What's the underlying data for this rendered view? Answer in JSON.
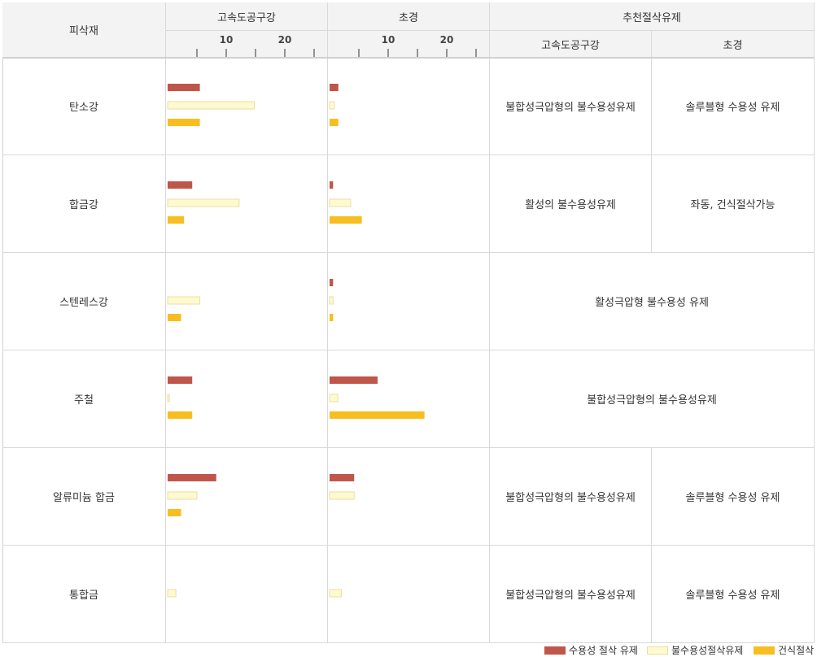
{
  "header": {
    "material": "피삭재",
    "group_a": "고속도공구강",
    "group_b": "초경",
    "recommend": "추천절삭유제",
    "rec_a": "고속도공구강",
    "rec_b": "초경"
  },
  "legend": {
    "water": "수용성 절삭 유제",
    "nonwater": "불수용성절삭유제",
    "dry": "건식절삭"
  },
  "colors": {
    "water": "#c0564a",
    "nonwater": "#fff9cf",
    "nonwater_border": "#e8dfa0",
    "dry": "#f8be1f"
  },
  "chart_data": {
    "type": "bar",
    "orientation": "horizontal",
    "xlim": [
      0,
      25
    ],
    "ticks": [
      10,
      20
    ],
    "series": [
      {
        "name": "수용성 절삭 유제"
      },
      {
        "name": "불수용성절삭유제"
      },
      {
        "name": "건식절삭"
      }
    ],
    "rows": [
      {
        "material": "탄소강",
        "hss": [
          5.5,
          14.8,
          5.5
        ],
        "carbide": [
          1.5,
          0.8,
          1.5
        ],
        "rec_hss": "불합성극압형의 불수용성유제",
        "rec_carbide": "솔루블형 수용성 유제"
      },
      {
        "material": "합금강",
        "hss": [
          4.2,
          12.2,
          2.8
        ],
        "carbide": [
          0.6,
          3.6,
          5.5
        ],
        "rec_hss": "활성의 불수용성유제",
        "rec_carbide": "좌동, 건식절삭가능"
      },
      {
        "material": "스텐레스강",
        "hss": [
          0,
          5.5,
          2.3
        ],
        "carbide": [
          0.6,
          0.6,
          0.6
        ],
        "rec_merged": "활성극압형 불수용성 유제"
      },
      {
        "material": "주철",
        "hss": [
          4.2,
          0.3,
          4.2
        ],
        "carbide": [
          8.2,
          1.4,
          16.2
        ],
        "rec_merged": "불합성극압형의 불수용성유제"
      },
      {
        "material": "알류미늄 합금",
        "hss": [
          8.3,
          5.0,
          2.3
        ],
        "carbide": [
          4.2,
          4.2,
          0
        ],
        "rec_hss": "불합성극압형의 불수용성유제",
        "rec_carbide": "솔루블형 수용성 유제"
      },
      {
        "material": "통합금",
        "hss": [
          0,
          1.4,
          0
        ],
        "carbide": [
          0,
          2.0,
          0
        ],
        "rec_hss": "불합성극압형의 불수용성유제",
        "rec_carbide": "솔루블형 수용성 유제"
      }
    ]
  }
}
